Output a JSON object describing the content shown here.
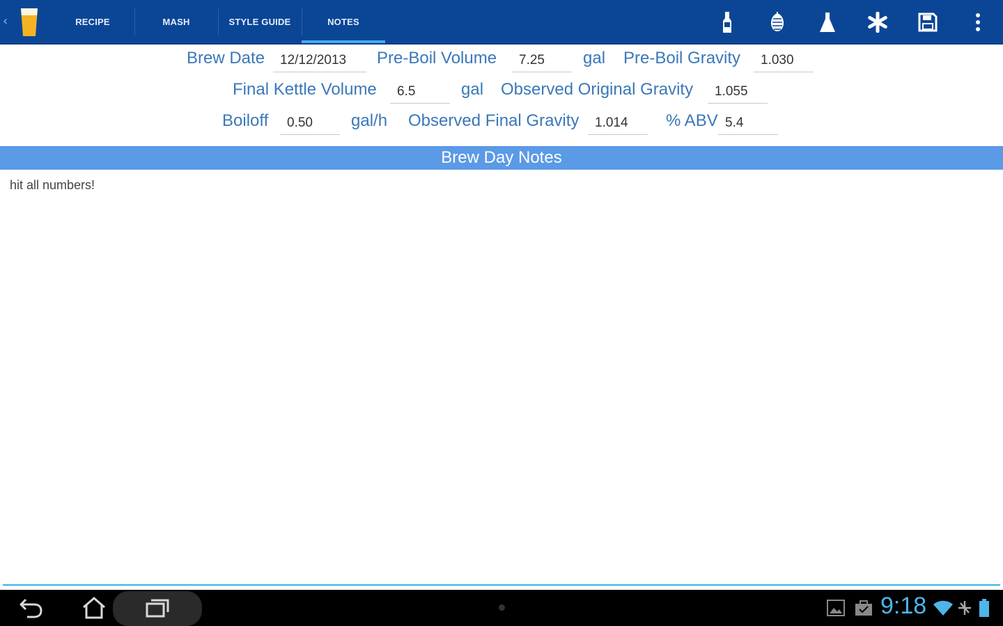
{
  "tabs": [
    {
      "label": "RECIPE"
    },
    {
      "label": "MASH"
    },
    {
      "label": "STYLE GUIDE"
    },
    {
      "label": "NOTES",
      "active": true
    }
  ],
  "actions": [
    "bottle-icon",
    "hop-icon",
    "flask-icon",
    "snowflake-icon",
    "save-icon",
    "overflow-menu-icon"
  ],
  "fields": {
    "brew_date": {
      "label": "Brew Date",
      "value": "12/12/2013"
    },
    "pre_boil_volume": {
      "label": "Pre-Boil Volume",
      "value": "7.25",
      "unit": "gal"
    },
    "pre_boil_gravity": {
      "label": "Pre-Boil Gravity",
      "value": "1.030"
    },
    "final_kettle_volume": {
      "label": "Final Kettle Volume",
      "value": "6.5",
      "unit": "gal"
    },
    "observed_og": {
      "label": "Observed Original Gravity",
      "value": "1.055"
    },
    "boiloff": {
      "label": "Boiloff",
      "value": "0.50",
      "unit": "gal/h"
    },
    "observed_fg": {
      "label": "Observed Final Gravity",
      "value": "1.014"
    },
    "abv": {
      "label": "% ABV",
      "value": "5.4"
    }
  },
  "notes": {
    "header": "Brew Day Notes",
    "text": "hit all numbers!"
  },
  "status": {
    "time": "9:18"
  },
  "colors": {
    "actionbar": "#0b4696",
    "label": "#3b78b8",
    "notes_header": "#5b9ae6",
    "clock": "#4fb4e8"
  }
}
